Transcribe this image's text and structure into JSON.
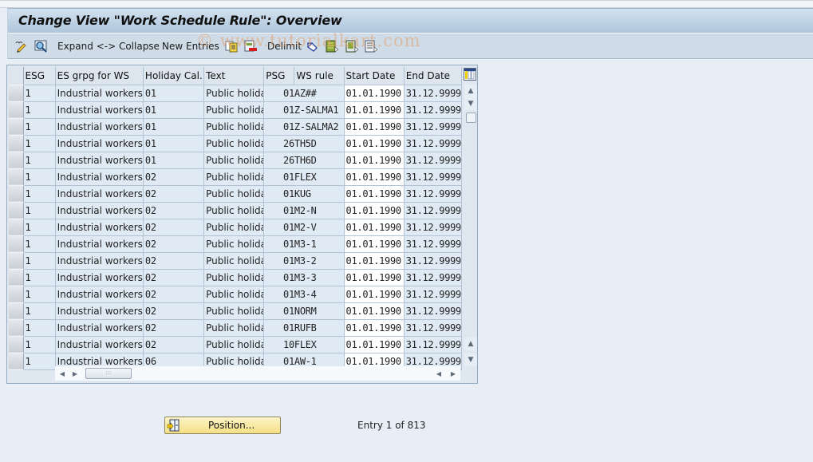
{
  "window": {
    "title": "Change View \"Work Schedule Rule\": Overview"
  },
  "toolbar": {
    "items": [
      {
        "type": "icon",
        "name": "display-change-icon"
      },
      {
        "type": "icon",
        "name": "find-icon"
      },
      {
        "type": "text",
        "label": "Expand <-> Collapse"
      },
      {
        "type": "text",
        "label": "New Entries"
      },
      {
        "type": "icon",
        "name": "copy-as-icon"
      },
      {
        "type": "icon",
        "name": "delete-icon"
      },
      {
        "type": "text",
        "label": "Delimit"
      },
      {
        "type": "icon",
        "name": "undo-change-icon"
      },
      {
        "type": "icon",
        "name": "select-all-icon"
      },
      {
        "type": "icon",
        "name": "select-block-icon"
      },
      {
        "type": "icon",
        "name": "deselect-all-icon"
      }
    ],
    "expand_collapse_label": "Expand <-> Collapse",
    "new_entries_label": "New Entries",
    "delimit_label": "Delimit"
  },
  "watermark": "© www.tutorialkart.com",
  "table": {
    "columns": [
      "ESG",
      "ES grpg for WS",
      "Holiday Cal...",
      "Text",
      "PSG",
      "WS rule",
      "Start Date",
      "End Date"
    ],
    "rows": [
      {
        "esg": "1",
        "es_grpg": "Industrial workers",
        "holiday_cal": "01",
        "text": "Public holida…",
        "psg": "01",
        "ws_rule": "AZ##",
        "start": "01.01.1990",
        "end": "31.12.9999"
      },
      {
        "esg": "1",
        "es_grpg": "Industrial workers",
        "holiday_cal": "01",
        "text": "Public holida…",
        "psg": "01",
        "ws_rule": "Z-SALMA1",
        "start": "01.01.1990",
        "end": "31.12.9999"
      },
      {
        "esg": "1",
        "es_grpg": "Industrial workers",
        "holiday_cal": "01",
        "text": "Public holida…",
        "psg": "01",
        "ws_rule": "Z-SALMA2",
        "start": "01.01.1990",
        "end": "31.12.9999"
      },
      {
        "esg": "1",
        "es_grpg": "Industrial workers",
        "holiday_cal": "01",
        "text": "Public holida…",
        "psg": "26",
        "ws_rule": "TH5D",
        "start": "01.01.1990",
        "end": "31.12.9999"
      },
      {
        "esg": "1",
        "es_grpg": "Industrial workers",
        "holiday_cal": "01",
        "text": "Public holida…",
        "psg": "26",
        "ws_rule": "TH6D",
        "start": "01.01.1990",
        "end": "31.12.9999"
      },
      {
        "esg": "1",
        "es_grpg": "Industrial workers",
        "holiday_cal": "02",
        "text": "Public holida…",
        "psg": "01",
        "ws_rule": "FLEX",
        "start": "01.01.1990",
        "end": "31.12.9999"
      },
      {
        "esg": "1",
        "es_grpg": "Industrial workers",
        "holiday_cal": "02",
        "text": "Public holida…",
        "psg": "01",
        "ws_rule": "KUG",
        "start": "01.01.1990",
        "end": "31.12.9999"
      },
      {
        "esg": "1",
        "es_grpg": "Industrial workers",
        "holiday_cal": "02",
        "text": "Public holida…",
        "psg": "01",
        "ws_rule": "M2-N",
        "start": "01.01.1990",
        "end": "31.12.9999"
      },
      {
        "esg": "1",
        "es_grpg": "Industrial workers",
        "holiday_cal": "02",
        "text": "Public holida…",
        "psg": "01",
        "ws_rule": "M2-V",
        "start": "01.01.1990",
        "end": "31.12.9999"
      },
      {
        "esg": "1",
        "es_grpg": "Industrial workers",
        "holiday_cal": "02",
        "text": "Public holida…",
        "psg": "01",
        "ws_rule": "M3-1",
        "start": "01.01.1990",
        "end": "31.12.9999"
      },
      {
        "esg": "1",
        "es_grpg": "Industrial workers",
        "holiday_cal": "02",
        "text": "Public holida…",
        "psg": "01",
        "ws_rule": "M3-2",
        "start": "01.01.1990",
        "end": "31.12.9999"
      },
      {
        "esg": "1",
        "es_grpg": "Industrial workers",
        "holiday_cal": "02",
        "text": "Public holida…",
        "psg": "01",
        "ws_rule": "M3-3",
        "start": "01.01.1990",
        "end": "31.12.9999"
      },
      {
        "esg": "1",
        "es_grpg": "Industrial workers",
        "holiday_cal": "02",
        "text": "Public holida…",
        "psg": "01",
        "ws_rule": "M3-4",
        "start": "01.01.1990",
        "end": "31.12.9999"
      },
      {
        "esg": "1",
        "es_grpg": "Industrial workers",
        "holiday_cal": "02",
        "text": "Public holida…",
        "psg": "01",
        "ws_rule": "NORM",
        "start": "01.01.1990",
        "end": "31.12.9999"
      },
      {
        "esg": "1",
        "es_grpg": "Industrial workers",
        "holiday_cal": "02",
        "text": "Public holida…",
        "psg": "01",
        "ws_rule": "RUFB",
        "start": "01.01.1990",
        "end": "31.12.9999"
      },
      {
        "esg": "1",
        "es_grpg": "Industrial workers",
        "holiday_cal": "02",
        "text": "Public holida…",
        "psg": "10",
        "ws_rule": "FLEX",
        "start": "01.01.1990",
        "end": "31.12.9999"
      },
      {
        "esg": "1",
        "es_grpg": "Industrial workers",
        "holiday_cal": "06",
        "text": "Public holida…",
        "psg": "01",
        "ws_rule": "AW-1",
        "start": "01.01.1990",
        "end": "31.12.9999"
      }
    ]
  },
  "footer": {
    "position_button_label": "Position...",
    "entry_info": "Entry 1 of 813"
  },
  "colors": {
    "title_gradient_top": "#d2e1ee",
    "title_gradient_bottom": "#aec6dd",
    "toolbar_bg": "#cfdce7",
    "cell_bg": "#dfeaf5",
    "editable_cell_bg": "#ffffff",
    "position_button_bg": "#f5df84"
  }
}
